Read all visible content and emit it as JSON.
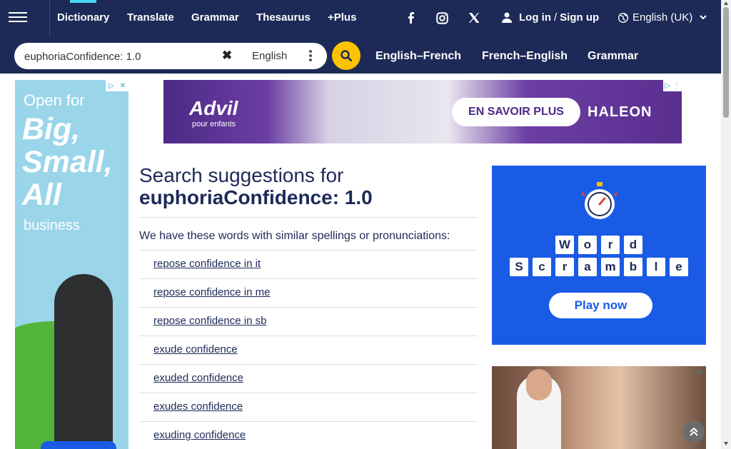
{
  "nav": {
    "items": [
      {
        "label": "Dictionary"
      },
      {
        "label": "Translate"
      },
      {
        "label": "Grammar"
      },
      {
        "label": "Thesaurus"
      },
      {
        "label": "+Plus"
      }
    ],
    "login": "Log in",
    "slash": "/",
    "signup": "Sign up",
    "language": "English (UK)"
  },
  "search": {
    "value": "euphoriaConfidence: 1.0",
    "dictionary": "English"
  },
  "quick_links": [
    "English–French",
    "French–English",
    "Grammar"
  ],
  "main": {
    "title_prefix": "Search suggestions for",
    "query": "euphoriaConfidence: 1.0",
    "intro": "We have these words with similar spellings or pronunciations:",
    "suggestions": [
      "repose confidence in it",
      "repose confidence in me",
      "repose confidence in sb",
      "exude confidence",
      "exuded confidence",
      "exudes confidence",
      "exuding confidence"
    ]
  },
  "ads": {
    "left": {
      "line1": "Open for",
      "line2": "Big, Small, All",
      "line3": "business"
    },
    "top": {
      "brand1": "Advil",
      "brand1_sub": "pour enfants",
      "cta": "EN SAVOIR PLUS",
      "brand2": "HALEON"
    },
    "right": {
      "row1": [
        "W",
        "o",
        "r",
        "d"
      ],
      "row2": [
        "S",
        "c",
        "r",
        "a",
        "m",
        "b",
        "l",
        "e"
      ],
      "cta": "Play now"
    }
  },
  "colors": {
    "navy": "#1d2a57",
    "accent": "#ffc200",
    "cyan": "#49d9f5"
  }
}
